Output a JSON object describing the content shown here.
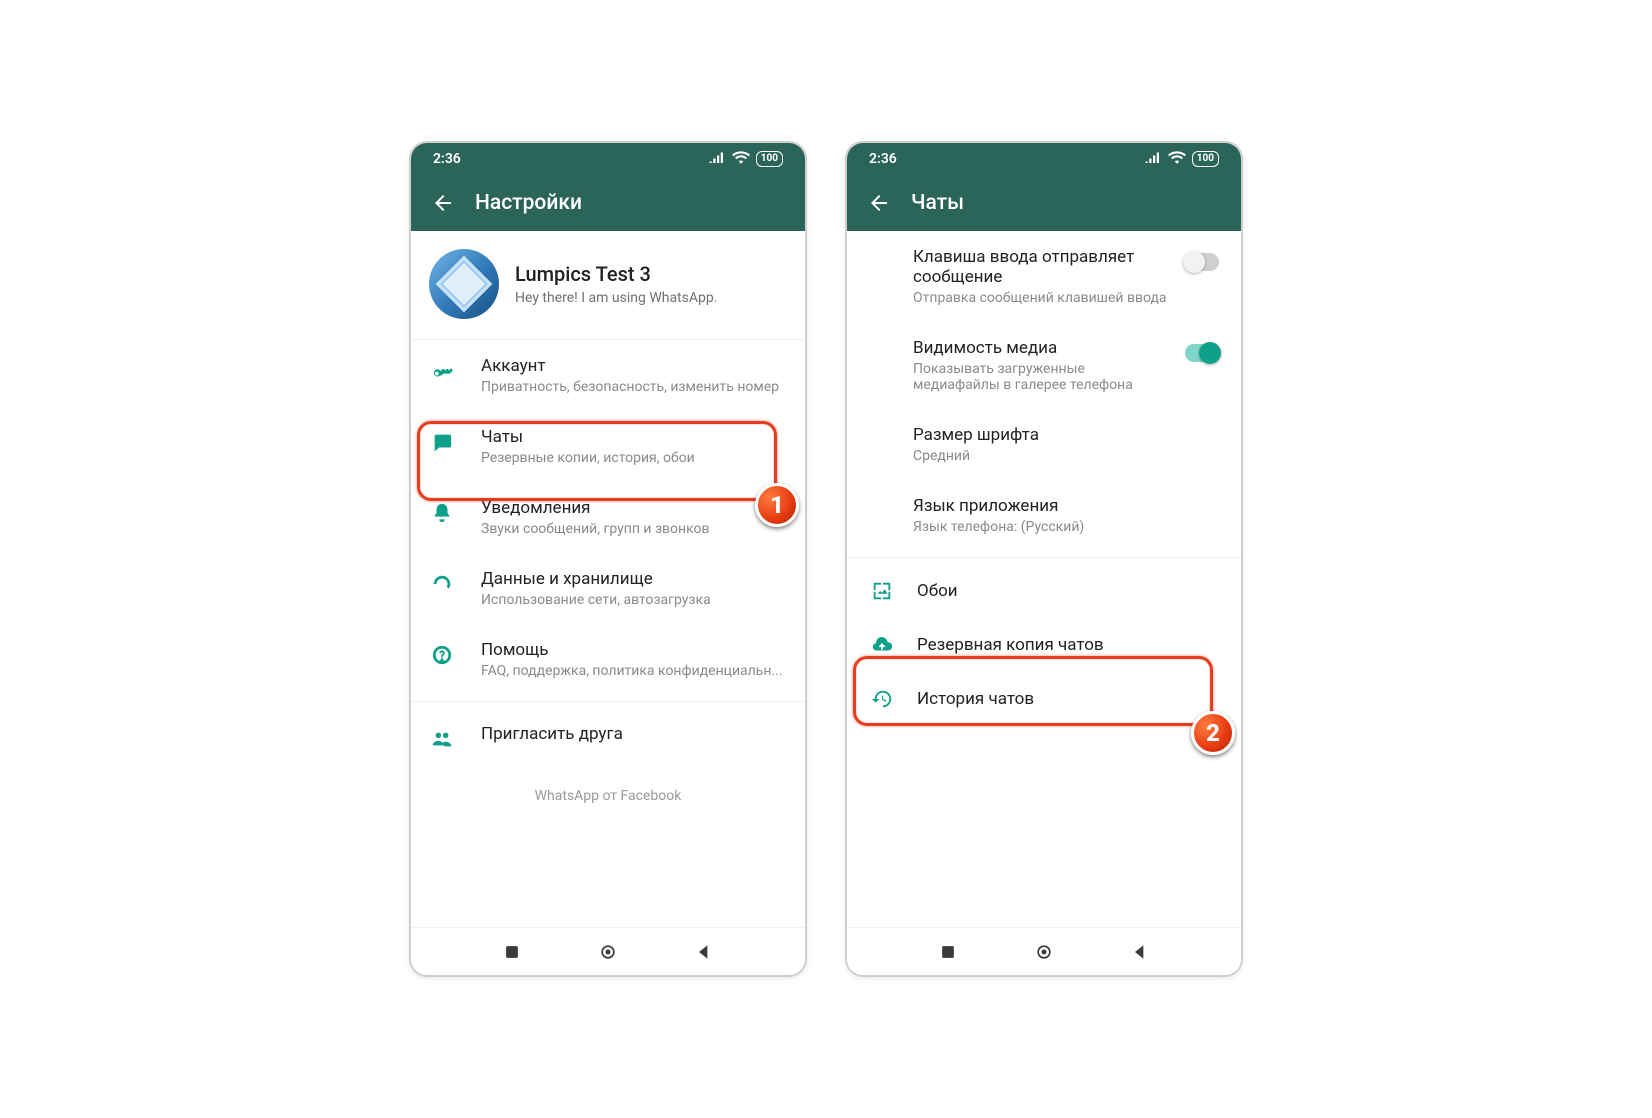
{
  "status": {
    "time": "2:36",
    "battery": "100"
  },
  "phone1": {
    "header_title": "Настройки",
    "profile": {
      "name": "Lumpics Test 3",
      "status": "Hey there! I am using WhatsApp."
    },
    "items": {
      "account": {
        "title": "Аккаунт",
        "sub": "Приватность, безопасность, изменить номер"
      },
      "chats": {
        "title": "Чаты",
        "sub": "Резервные копии, история, обои"
      },
      "notifs": {
        "title": "Уведомления",
        "sub": "Звуки сообщений, групп и звонков"
      },
      "data": {
        "title": "Данные и хранилище",
        "sub": "Использование сети, автозагрузка"
      },
      "help": {
        "title": "Помощь",
        "sub": "FAQ, поддержка, политика конфиденциальн..."
      },
      "invite": {
        "title": "Пригласить друга"
      }
    },
    "footer": "WhatsApp от Facebook",
    "callout_badge": "1"
  },
  "phone2": {
    "header_title": "Чаты",
    "rows": {
      "enter_send": {
        "title": "Клавиша ввода отправляет сообщение",
        "sub": "Отправка сообщений клавишей ввода",
        "on": false
      },
      "media_vis": {
        "title": "Видимость медиа",
        "sub": "Показывать загруженные медиафайлы в галерее телефона",
        "on": true
      },
      "font_size": {
        "title": "Размер шрифта",
        "sub": "Средний"
      },
      "lang": {
        "title": "Язык приложения",
        "sub": "Язык телефона: (Русский)"
      }
    },
    "sections": {
      "wallpaper": "Обои",
      "backup": "Резервная копия чатов",
      "history": "История чатов"
    },
    "callout_badge": "2"
  }
}
